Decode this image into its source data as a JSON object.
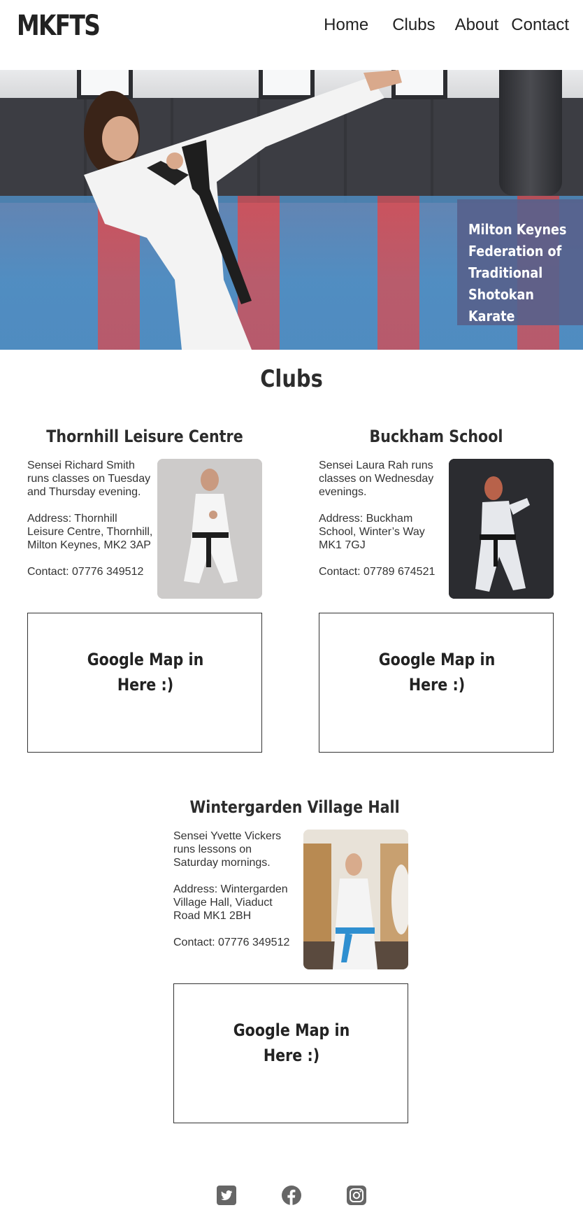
{
  "header": {
    "logo": "MKFTS",
    "nav": [
      "Home",
      "Clubs",
      "About",
      "Contact"
    ]
  },
  "hero": {
    "caption": "Milton Keynes Federation of Traditional Shotokan Karate"
  },
  "main": {
    "title": "Clubs",
    "clubs": [
      {
        "name": "Thornhill Leisure Centre",
        "description": "Sensei Richard Smith runs classes on Tuesday and Thursday evening.",
        "address": "Address: Thornhill Leisure Centre, Thornhill, Milton Keynes, MK2 3AP",
        "contact": "Contact: 07776 349512",
        "map_placeholder": "Google Map in Here :)"
      },
      {
        "name": "Buckham School",
        "description": "Sensei Laura Rah runs classes on Wednesday evenings.",
        "address": "Address: Buckham School, Winter’s Way MK1 7GJ",
        "contact": "Contact: 07789 674521",
        "map_placeholder": "Google Map in Here :)"
      },
      {
        "name": "Wintergarden Village Hall",
        "description": "Sensei Yvette Vickers runs lessons on Saturday mornings.",
        "address": "Address: Wintergarden Village Hall, Viaduct Road MK1 2BH",
        "contact": "Contact: 07776 349512",
        "map_placeholder": "Google Map in Here :)"
      }
    ]
  },
  "footer": {
    "social_icons": [
      "twitter-icon",
      "facebook-icon",
      "instagram-icon"
    ]
  },
  "colors": {
    "text": "#333333",
    "caption_bg": "#57608c",
    "social_icon": "#666666"
  }
}
